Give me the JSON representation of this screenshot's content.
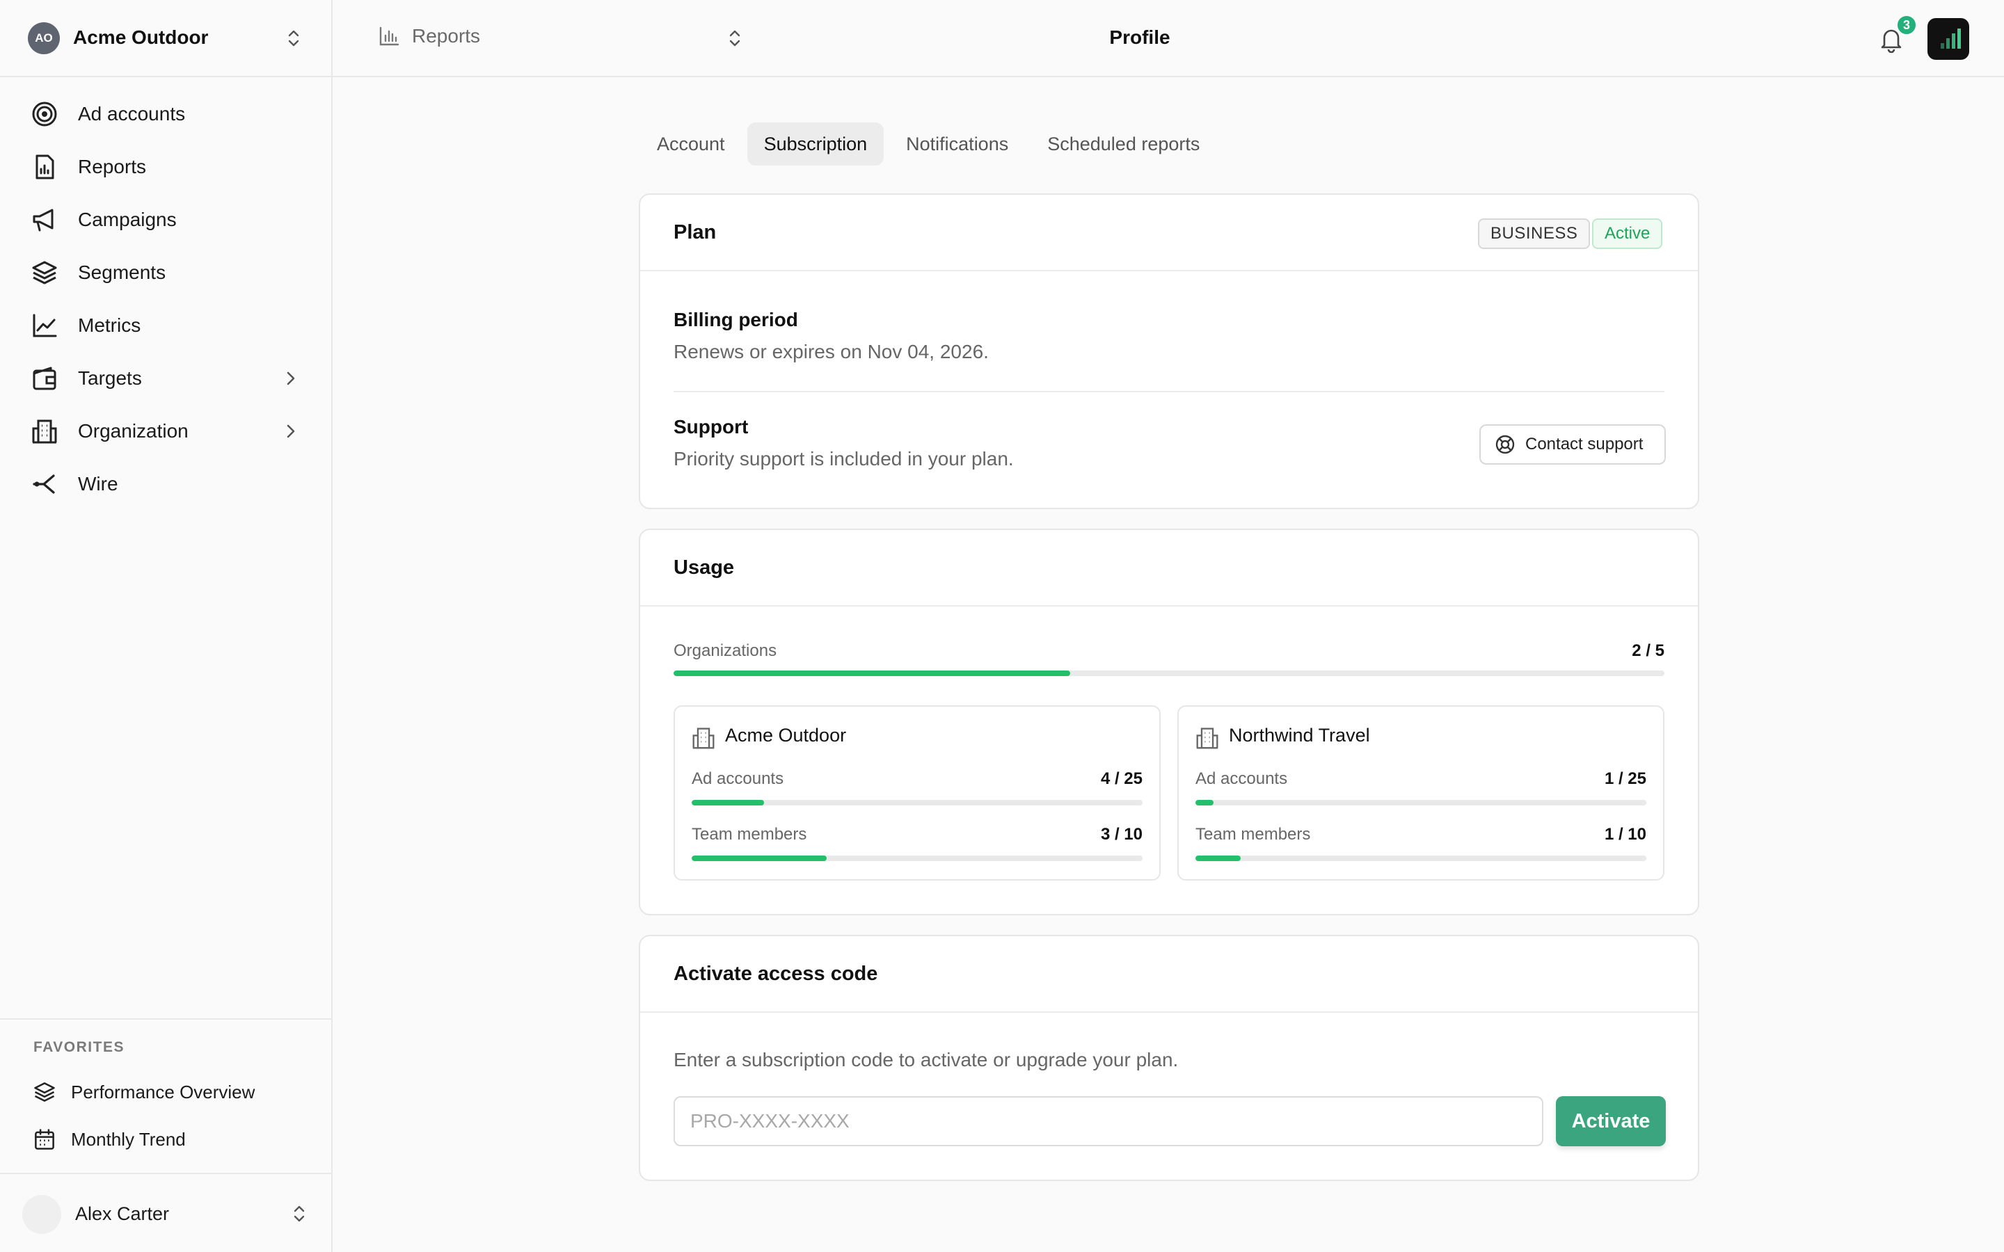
{
  "org": {
    "initials": "AO",
    "name": "Acme Outdoor"
  },
  "sidebar": {
    "items": [
      {
        "label": "Ad accounts",
        "icon": "target-icon"
      },
      {
        "label": "Reports",
        "icon": "report-icon"
      },
      {
        "label": "Campaigns",
        "icon": "megaphone-icon"
      },
      {
        "label": "Segments",
        "icon": "layers-icon"
      },
      {
        "label": "Metrics",
        "icon": "line-chart-icon"
      },
      {
        "label": "Targets",
        "icon": "wallet-icon"
      },
      {
        "label": "Organization",
        "icon": "building-icon"
      },
      {
        "label": "Wire",
        "icon": "branch-icon"
      }
    ],
    "favorites_title": "FAVORITES",
    "favorites": [
      {
        "label": "Performance Overview",
        "icon": "layers-icon"
      },
      {
        "label": "Monthly Trend",
        "icon": "calendar-icon"
      }
    ],
    "user": {
      "name": "Alex Carter"
    }
  },
  "topbar": {
    "breadcrumb": "Reports",
    "title": "Profile",
    "notification_count": "3"
  },
  "tabs": [
    {
      "label": "Account",
      "active": false
    },
    {
      "label": "Subscription",
      "active": true
    },
    {
      "label": "Notifications",
      "active": false
    },
    {
      "label": "Scheduled reports",
      "active": false
    }
  ],
  "plan": {
    "title": "Plan",
    "tier": "BUSINESS",
    "status": "Active",
    "billing_title": "Billing period",
    "billing_text": "Renews or expires on Nov 04, 2026.",
    "support_title": "Support",
    "support_text": "Priority support is included in your plan.",
    "contact_label": "Contact support"
  },
  "usage": {
    "title": "Usage",
    "organizations": {
      "label": "Organizations",
      "used": 2,
      "limit": 5,
      "text": "2 / 5"
    },
    "orgs": [
      {
        "name": "Acme Outdoor",
        "ad_accounts": {
          "label": "Ad accounts",
          "used": 4,
          "limit": 25,
          "text": "4 / 25"
        },
        "team_members": {
          "label": "Team members",
          "used": 3,
          "limit": 10,
          "text": "3 / 10"
        }
      },
      {
        "name": "Northwind Travel",
        "ad_accounts": {
          "label": "Ad accounts",
          "used": 1,
          "limit": 25,
          "text": "1 / 25"
        },
        "team_members": {
          "label": "Team members",
          "used": 1,
          "limit": 10,
          "text": "1 / 10"
        }
      }
    ]
  },
  "access_code": {
    "title": "Activate access code",
    "description": "Enter a subscription code to activate or upgrade your plan.",
    "placeholder": "PRO-XXXX-XXXX",
    "value": "",
    "button": "Activate"
  },
  "colors": {
    "accent": "#22c06a",
    "button": "#3aa57e",
    "badge_green": "#22b07d"
  }
}
